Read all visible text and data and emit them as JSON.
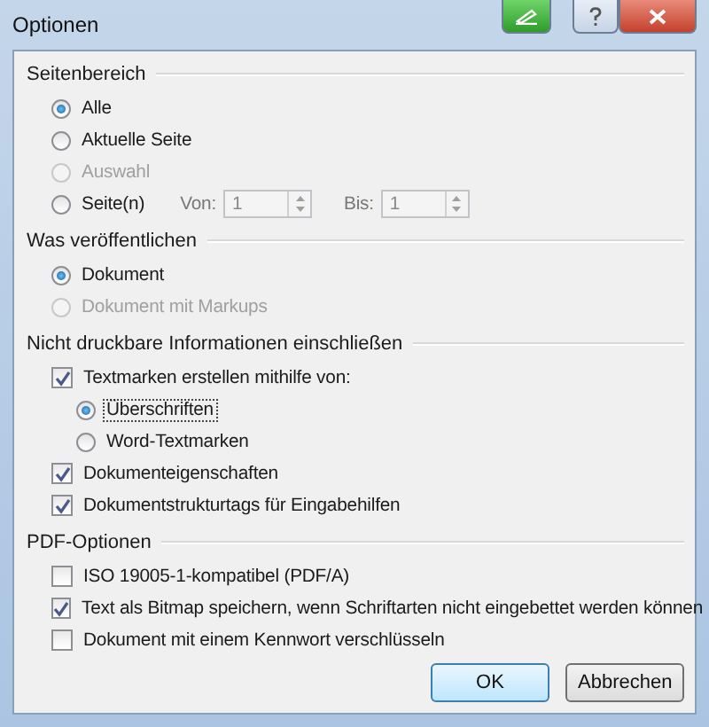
{
  "window": {
    "title": "Optionen"
  },
  "sections": [
    {
      "title": "Seitenbereich",
      "items": [
        {
          "kind": "radio",
          "label": "Alle",
          "selected": true,
          "disabled": false
        },
        {
          "kind": "radio",
          "label": "Aktuelle Seite",
          "selected": false,
          "disabled": false
        },
        {
          "kind": "radio",
          "label": "Auswahl",
          "selected": false,
          "disabled": true
        },
        {
          "kind": "radio",
          "label": "Seite(n)",
          "selected": false,
          "disabled": false,
          "fields": [
            {
              "label": "Von:",
              "value": "1",
              "disabled": true
            },
            {
              "label": "Bis:",
              "value": "1",
              "disabled": true
            }
          ]
        }
      ]
    },
    {
      "title": "Was veröffentlichen",
      "items": [
        {
          "kind": "radio",
          "label": "Dokument",
          "selected": true,
          "disabled": false
        },
        {
          "kind": "radio",
          "label": "Dokument mit Markups",
          "selected": false,
          "disabled": true
        }
      ]
    },
    {
      "title": "Nicht druckbare Informationen einschließen",
      "items": [
        {
          "kind": "checkbox",
          "label": "Textmarken erstellen mithilfe von:",
          "checked": true,
          "disabled": false,
          "children": [
            {
              "kind": "radio",
              "label": "Überschriften",
              "selected": true,
              "disabled": false,
              "focused": true
            },
            {
              "kind": "radio",
              "label": "Word-Textmarken",
              "selected": false,
              "disabled": false,
              "focused": false
            }
          ]
        },
        {
          "kind": "checkbox",
          "label": "Dokumenteigenschaften",
          "checked": true,
          "disabled": false
        },
        {
          "kind": "checkbox",
          "label": "Dokumentstrukturtags für Eingabehilfen",
          "checked": true,
          "disabled": false
        }
      ]
    },
    {
      "title": "PDF-Optionen",
      "items": [
        {
          "kind": "checkbox",
          "label": "ISO 19005-1-kompatibel (PDF/A)",
          "checked": false,
          "disabled": false
        },
        {
          "kind": "checkbox",
          "label": "Text als Bitmap speichern, wenn Schriftarten nicht eingebettet werden können",
          "checked": true,
          "disabled": false
        },
        {
          "kind": "checkbox",
          "label": "Dokument mit einem Kennwort verschlüsseln",
          "checked": false,
          "disabled": false
        }
      ]
    }
  ],
  "buttons": [
    {
      "label": "OK",
      "default": true
    },
    {
      "label": "Abbrechen",
      "default": false
    }
  ]
}
